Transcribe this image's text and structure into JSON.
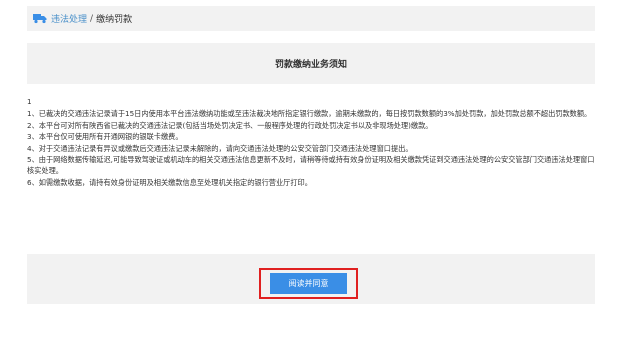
{
  "breadcrumb": {
    "icon": "truck-icon",
    "icon_color": "#3a8ee6",
    "link": "违法处理",
    "separator": "/",
    "current": "缴纳罚款"
  },
  "notice": {
    "title": "罚款缴纳业务须知",
    "page_number": "1",
    "items": [
      "1、已裁决的交通违法记录请于15日内使用本平台违法缴纳功能或至违法裁决地所指定银行缴款，逾期未缴款的，每日按罚款数额的3%加处罚款，加处罚款总额不超出罚款数额。",
      "2、本平台可对所有陕西省已裁决的交通违法记录(包括当场处罚决定书、一般程序处理的行政处罚决定书以及非现场处理)缴款。",
      "3、本平台仅可使用所有开通网银的银联卡缴费。",
      "4、对于交通违法记录有异议或缴款后交通违法记录未解除的，请向交通违法处理的公安交管部门交通违法处理窗口提出。",
      "5、由于网络数据传输延迟,可能导致驾驶证或机动车的相关交通违法信息更新不及时，请稍等待或持有效身份证明及相关缴款凭证到交通违法处理的公安交管部门交通违法处理窗口核实处理。",
      "6、如需缴款收据，请持有效身份证明及相关缴款信息至处理机关指定的银行营业厅打印。"
    ]
  },
  "actions": {
    "agree_label": "阅读并同意",
    "button_color": "#3a8ee6",
    "highlight_color": "#e02020"
  }
}
